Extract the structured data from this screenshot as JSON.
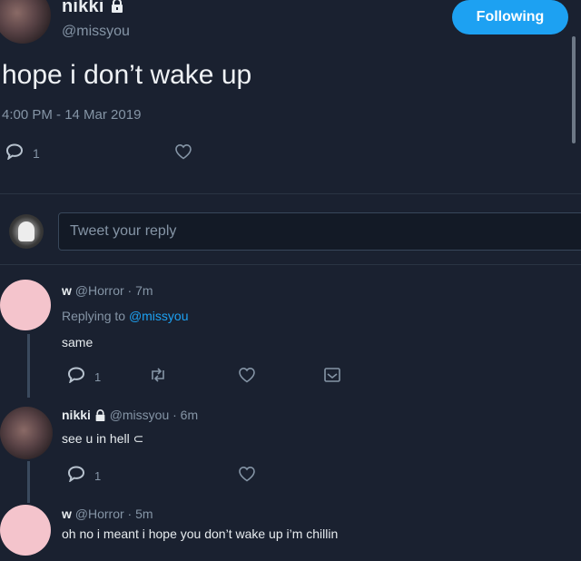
{
  "header": {
    "author_name": "nikki",
    "author_handle": "@missyou",
    "follow_label": "Following"
  },
  "tweet": {
    "text": "hope i don’t wake up",
    "timestamp": "4:00 PM - 14 Mar 2019",
    "reply_count": "1"
  },
  "composer": {
    "placeholder": "Tweet your reply"
  },
  "replies": [
    {
      "author_name": "w",
      "handle_time": "@Horror · 7m",
      "replying_prefix": "Replying to",
      "replying_to": "@missyou",
      "text": "same",
      "reply_count": "1"
    },
    {
      "author_name": "nikki",
      "handle_time": "@missyou · 6m",
      "text": "see u in hell ⊂",
      "reply_count": "1"
    },
    {
      "author_name": "w",
      "handle_time": "@Horror · 5m",
      "text": "oh no i meant i hope you don’t wake up i’m chillin"
    }
  ],
  "colors": {
    "background": "#1a2130",
    "accent": "#1da1f2",
    "muted_text": "#8595a6",
    "avatar_pink": "#f4c4cc"
  },
  "icons": {
    "reply": "speech-bubble-icon",
    "retweet": "retweet-icon",
    "like": "heart-icon",
    "dm": "envelope-icon",
    "lock": "lock-icon"
  }
}
